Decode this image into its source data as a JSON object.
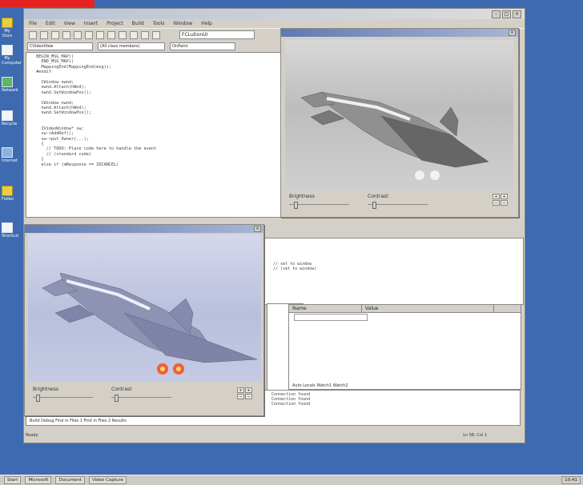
{
  "ide": {
    "window_controls": [
      "–",
      "□",
      "×"
    ],
    "menu": [
      "File",
      "Edit",
      "View",
      "Insert",
      "Project",
      "Build",
      "Tools",
      "Window",
      "Help"
    ],
    "find_text": "FCLutionUI",
    "combos": [
      "CVideoView",
      "(All class members)",
      "OnPaint"
    ],
    "code_lines": [
      "  BEGIN_MSG_MAP()",
      "    END_MSG_MAP()",
      "    MappingEnd(MappingEnd(msg));",
      "  #endif",
      "",
      "    CWindow nwnd;",
      "    nwnd.Attach(hWnd);",
      "    nwnd.SetWindowPos();",
      "",
      "    CWindow nwnd;",
      "    nwnd.Attach(hWnd);",
      "    nwnd.SetWindowPos();",
      "",
      "",
      "    IVideoWindow* vw;",
      "    vw->AddRef();",
      "    vw->put_Owner(...);",
      "    {",
      "      // TODO: Place code here to handle the event",
      "      // (standard code)",
      "    }",
      "    else if (mResponse == IDCANCEL)"
    ],
    "output_lines": [
      "",
      "",
      "  // set to window",
      "  // (set to window)"
    ],
    "watch_columns": [
      "Name",
      "Value"
    ],
    "watch_tabs": "Auto  Locals  Watch1  Watch2",
    "log_lines": [
      "Connection found",
      "Connection found",
      "Connection found"
    ],
    "log_tabs": "Build  Debug  Find in Files 1  Find in Files 2  Results",
    "status_left": "Ready",
    "status_right": "Ln 58, Col 1"
  },
  "image_window_top": {
    "controls": [
      {
        "label": "Brightness",
        "value": 0.08
      },
      {
        "label": "Contrast",
        "value": 0.08
      }
    ],
    "spin": [
      "+",
      "+",
      "−",
      "−"
    ]
  },
  "image_window_bottom": {
    "controls": [
      {
        "label": "Brightness",
        "value": 0.06
      },
      {
        "label": "Contrast",
        "value": 0.06
      }
    ],
    "spin": [
      "+",
      "+",
      "−",
      "−"
    ]
  },
  "taskbar": {
    "items": [
      "Start",
      "Microsoft",
      "Document",
      "Video Capture"
    ],
    "tray": "10:41"
  },
  "desktop_icons": [
    {
      "label": "My Docs",
      "color": "y"
    },
    {
      "label": "My Computer",
      "color": "w"
    },
    {
      "label": "Network",
      "color": "g"
    },
    {
      "label": "Recycle",
      "color": "w"
    },
    {
      "label": "Internet",
      "color": "b"
    },
    {
      "label": "Folder",
      "color": "y"
    },
    {
      "label": "Shortcut",
      "color": "w"
    }
  ],
  "colors": {
    "desktop": "#3d6ab0",
    "title_active": "#5f79b3",
    "accent_red": "#e42322"
  }
}
